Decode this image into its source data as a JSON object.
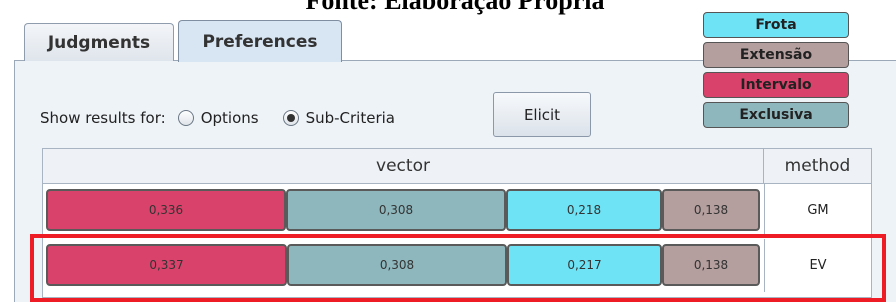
{
  "caption": "Fonte: Elaboração Própria",
  "tabs": [
    {
      "label": "Judgments",
      "selected": false
    },
    {
      "label": "Preferences",
      "selected": true
    }
  ],
  "show_results": {
    "label": "Show results for:",
    "options": [
      {
        "label": "Options",
        "checked": false
      },
      {
        "label": "Sub-Criteria",
        "checked": true
      }
    ],
    "elicit_button": "Elicit"
  },
  "legend": [
    {
      "label": "Frota",
      "color": "#6ee3f5"
    },
    {
      "label": "Extensão",
      "color": "#b49e9e"
    },
    {
      "label": "Intervalo",
      "color": "#d9436b"
    },
    {
      "label": "Exclusiva",
      "color": "#8eb7bd"
    }
  ],
  "table": {
    "headers": {
      "vector": "vector",
      "method": "method"
    },
    "rows": [
      {
        "method": "GM",
        "segments": [
          {
            "label": "0,336",
            "value": 0.336,
            "color": "#d9436b",
            "criterion": "Intervalo"
          },
          {
            "label": "0,308",
            "value": 0.308,
            "color": "#8eb7bd",
            "criterion": "Exclusiva"
          },
          {
            "label": "0,218",
            "value": 0.218,
            "color": "#6ee3f5",
            "criterion": "Frota"
          },
          {
            "label": "0,138",
            "value": 0.138,
            "color": "#b49e9e",
            "criterion": "Extensão"
          }
        ]
      },
      {
        "method": "EV",
        "segments": [
          {
            "label": "0,337",
            "value": 0.337,
            "color": "#d9436b",
            "criterion": "Intervalo"
          },
          {
            "label": "0,308",
            "value": 0.308,
            "color": "#8eb7bd",
            "criterion": "Exclusiva"
          },
          {
            "label": "0,217",
            "value": 0.217,
            "color": "#6ee3f5",
            "criterion": "Frota"
          },
          {
            "label": "0,138",
            "value": 0.138,
            "color": "#b49e9e",
            "criterion": "Extensão"
          }
        ]
      }
    ]
  },
  "highlight_color": "#ee1c24"
}
